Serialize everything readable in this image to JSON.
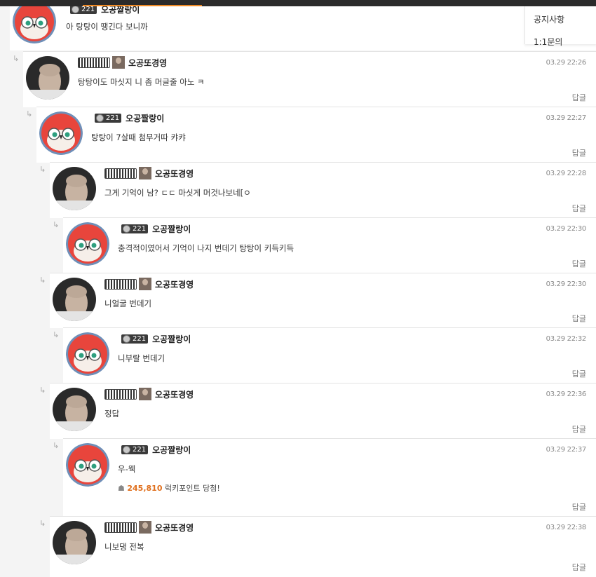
{
  "menu": {
    "notice": "공지사항",
    "inquiry": "1:1문의"
  },
  "top_comment": {
    "level": "221",
    "nick": "오공짤랑이",
    "text": "아 탕탕이 땡긴다 보니까"
  },
  "comments": [
    {
      "nick": "오공또경영",
      "type": "photo",
      "date": "03.29 22:26",
      "text": "탕탕이도 마싯지 니 좀 머글줄 아노 ㅋ",
      "reply": "답글"
    },
    {
      "nick": "오공짤랑이",
      "type": "bird",
      "level": "221",
      "date": "03.29 22:27",
      "text": "탕탕이 7살때 첨무거따 캬캬",
      "reply": "답글"
    },
    {
      "nick": "오공또경영",
      "type": "photo",
      "date": "03.29 22:28",
      "text": "그게 기억이 남? ㄷㄷ 마싯게 머것나보네[ㅇ",
      "reply": "답글"
    },
    {
      "nick": "오공짤랑이",
      "type": "bird",
      "level": "221",
      "date": "03.29 22:30",
      "text": "충격적이였어서 기억이 나지 번데기 탕탕이 키득키득",
      "reply": "답글"
    },
    {
      "nick": "오공또경영",
      "type": "photo",
      "date": "03.29 22:30",
      "text": "니얼굴 번데기",
      "reply": "답글"
    },
    {
      "nick": "오공짤랑이",
      "type": "bird",
      "level": "221",
      "date": "03.29 22:32",
      "text": "니부랄 번데기",
      "reply": "답글"
    },
    {
      "nick": "오공또경영",
      "type": "photo",
      "date": "03.29 22:36",
      "text": "정답",
      "reply": "답글"
    },
    {
      "nick": "오공짤랑이",
      "type": "bird",
      "level": "221",
      "date": "03.29 22:37",
      "text": "우-웩",
      "reply": "답글",
      "lucky_amount": "245,810",
      "lucky_text": "럭키포인트 당첨!"
    },
    {
      "nick": "오공또경영",
      "type": "photo",
      "date": "03.29 22:38",
      "text": "니보댕 전복",
      "reply": "답글"
    }
  ]
}
